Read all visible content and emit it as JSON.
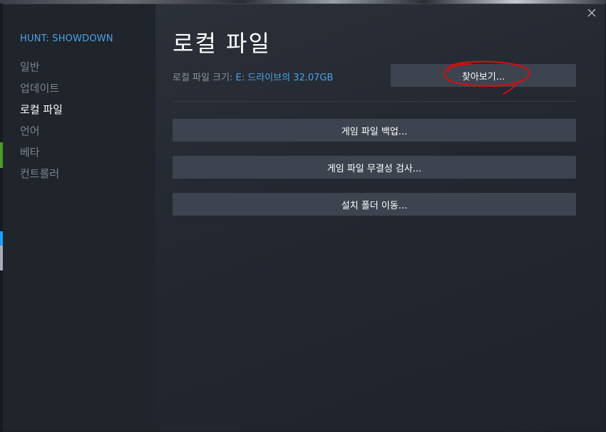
{
  "sidebar": {
    "game_title": "HUNT: SHOWDOWN",
    "items": [
      {
        "label": "일반"
      },
      {
        "label": "업데이트"
      },
      {
        "label": "로컬 파일"
      },
      {
        "label": "언어"
      },
      {
        "label": "베타"
      },
      {
        "label": "컨트롤러"
      }
    ],
    "active_index": 2
  },
  "main": {
    "title": "로컬 파일",
    "size_label": "로컬 파일 크기:",
    "size_value": "E: 드라이브의 32.07GB",
    "browse_label": "찾아보기...",
    "backup_label": "게임 파일 백업...",
    "verify_label": "게임 파일 무결성 검사...",
    "move_label": "설치 폴더 이동..."
  },
  "window": {
    "close_icon": "close-icon",
    "accent_color": "#4aa4e8",
    "annotation_color": "#cc1111"
  }
}
